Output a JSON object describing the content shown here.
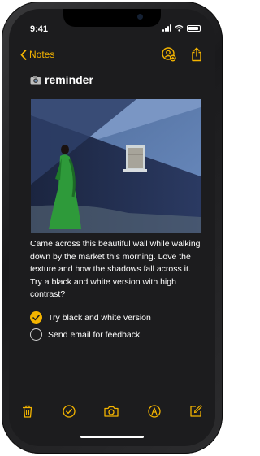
{
  "status": {
    "time": "9:41",
    "network": "signal-icon",
    "wifi": "wifi-icon",
    "battery": "battery-icon"
  },
  "nav": {
    "back_label": "Notes",
    "back_icon": "chevron-left-icon",
    "share_people_icon": "add-people-icon",
    "share_icon": "share-icon"
  },
  "note": {
    "title_emoji": "camera-icon",
    "title": "reminder",
    "photo": "photo-blue-wall-woman-green-dress",
    "body": "Came across this beautiful wall while walking down by the market this morning. Love the texture and how the shadows fall across it. Try a black and white version with high contrast?",
    "checklist": [
      {
        "label": "Try black and white version",
        "checked": true
      },
      {
        "label": "Send email for feedback",
        "checked": false
      }
    ]
  },
  "toolbar": {
    "items": [
      "trash-icon",
      "checklist-icon",
      "camera-icon",
      "markup-icon",
      "compose-icon"
    ]
  },
  "colors": {
    "accent": "#f4b400",
    "background": "#1c1c1e",
    "text": "#ffffff"
  }
}
